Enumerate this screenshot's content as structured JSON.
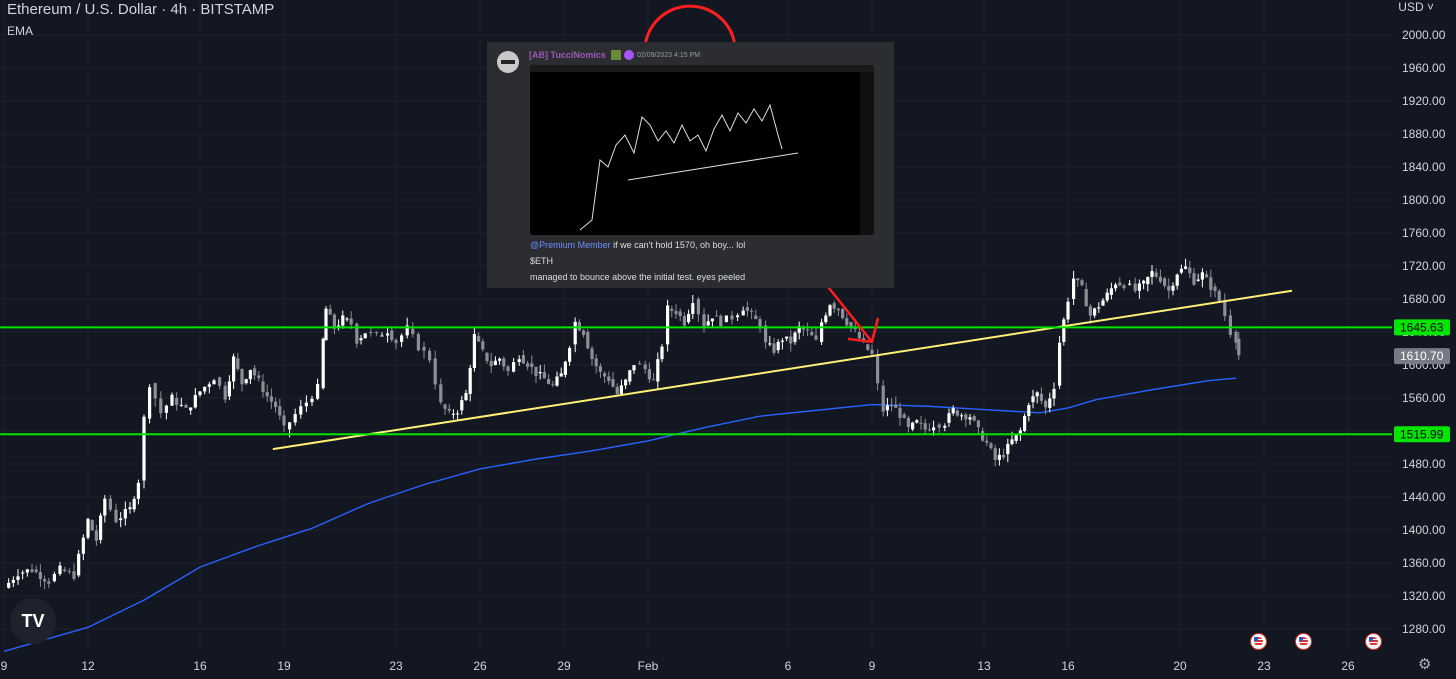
{
  "header": {
    "title": "Ethereum / U.S. Dollar · 4h · BITSTAMP",
    "indicator": "EMA",
    "currency": "USD"
  },
  "colors": {
    "background": "#131722",
    "candle_up": "#ffffff",
    "candle_down": "#8a8f98",
    "ema": "#2962ff",
    "trendline": "#fff176",
    "level": "#00e600",
    "annotation": "#ff1e1e"
  },
  "chart_data": {
    "type": "candlestick",
    "y_axis": {
      "min": 1260,
      "max": 2020,
      "ticks": [
        1280,
        1320,
        1360,
        1400,
        1440,
        1480,
        1520,
        1560,
        1600,
        1640,
        1680,
        1720,
        1760,
        1800,
        1840,
        1880,
        1920,
        1960,
        2000
      ],
      "tick_labels": [
        "1280.00",
        "1320.00",
        "1360.00",
        "1400.00",
        "1440.00",
        "1480.00",
        "1520.00",
        "1560.00",
        "1600.00",
        "1640.00",
        "1680.00",
        "1720.00",
        "1760.00",
        "1800.00",
        "1840.00",
        "1880.00",
        "1920.00",
        "1960.00",
        "2000.00"
      ]
    },
    "x_axis": {
      "min": 9,
      "max": 36.5,
      "ticks": [
        {
          "x": 9,
          "label": "9"
        },
        {
          "x": 12,
          "label": "12"
        },
        {
          "x": 16,
          "label": "16"
        },
        {
          "x": 19,
          "label": "19"
        },
        {
          "x": 23,
          "label": "23"
        },
        {
          "x": 26,
          "label": "26"
        },
        {
          "x": 29,
          "label": "29"
        },
        {
          "x": 32,
          "label": "Feb"
        },
        {
          "x": 37,
          "label": "6"
        },
        {
          "x": 40,
          "label": "9"
        },
        {
          "x": 44,
          "label": "13"
        },
        {
          "x": 47,
          "label": "16"
        },
        {
          "x": 51,
          "label": "20"
        },
        {
          "x": 54,
          "label": "23"
        },
        {
          "x": 57,
          "label": "26"
        }
      ]
    },
    "horizontal_levels": [
      {
        "price": 1645.63,
        "label": "1645.63"
      },
      {
        "price": 1515.99,
        "label": "1515.99"
      }
    ],
    "last_price": {
      "price": 1610.7,
      "label": "1610.70"
    },
    "price_path": [
      [
        9.0,
        1330
      ],
      [
        9.5,
        1348
      ],
      [
        10.0,
        1352
      ],
      [
        10.6,
        1338
      ],
      [
        11.0,
        1352
      ],
      [
        11.5,
        1345
      ],
      [
        12.0,
        1412
      ],
      [
        12.3,
        1388
      ],
      [
        12.6,
        1438
      ],
      [
        13.0,
        1412
      ],
      [
        13.5,
        1425
      ],
      [
        13.8,
        1460
      ],
      [
        14.0,
        1535
      ],
      [
        14.2,
        1578
      ],
      [
        14.6,
        1542
      ],
      [
        15.0,
        1560
      ],
      [
        15.5,
        1545
      ],
      [
        16.0,
        1568
      ],
      [
        16.5,
        1585
      ],
      [
        16.9,
        1562
      ],
      [
        17.2,
        1608
      ],
      [
        17.5,
        1578
      ],
      [
        17.8,
        1596
      ],
      [
        18.1,
        1580
      ],
      [
        18.4,
        1562
      ],
      [
        18.7,
        1550
      ],
      [
        19.0,
        1522
      ],
      [
        19.4,
        1540
      ],
      [
        19.8,
        1555
      ],
      [
        20.2,
        1572
      ],
      [
        20.4,
        1630
      ],
      [
        20.5,
        1668
      ],
      [
        20.8,
        1645
      ],
      [
        21.1,
        1656
      ],
      [
        21.4,
        1650
      ],
      [
        21.6,
        1630
      ],
      [
        21.9,
        1640
      ],
      [
        22.3,
        1635
      ],
      [
        22.7,
        1642
      ],
      [
        23.0,
        1628
      ],
      [
        23.4,
        1644
      ],
      [
        23.8,
        1622
      ],
      [
        24.2,
        1608
      ],
      [
        24.6,
        1552
      ],
      [
        24.9,
        1540
      ],
      [
        25.2,
        1545
      ],
      [
        25.5,
        1565
      ],
      [
        25.8,
        1635
      ],
      [
        26.1,
        1615
      ],
      [
        26.4,
        1600
      ],
      [
        26.7,
        1608
      ],
      [
        27.0,
        1592
      ],
      [
        27.4,
        1612
      ],
      [
        27.7,
        1602
      ],
      [
        28.0,
        1590
      ],
      [
        28.3,
        1583
      ],
      [
        28.6,
        1575
      ],
      [
        28.9,
        1588
      ],
      [
        29.2,
        1625
      ],
      [
        29.4,
        1652
      ],
      [
        29.7,
        1640
      ],
      [
        30.0,
        1608
      ],
      [
        30.3,
        1590
      ],
      [
        30.6,
        1583
      ],
      [
        30.9,
        1565
      ],
      [
        31.2,
        1580
      ],
      [
        31.5,
        1602
      ],
      [
        31.9,
        1595
      ],
      [
        32.2,
        1580
      ],
      [
        32.5,
        1625
      ],
      [
        32.7,
        1668
      ],
      [
        33.0,
        1665
      ],
      [
        33.3,
        1652
      ],
      [
        33.6,
        1680
      ],
      [
        34.0,
        1648
      ],
      [
        34.3,
        1660
      ],
      [
        34.6,
        1652
      ],
      [
        35.0,
        1658
      ],
      [
        35.4,
        1670
      ],
      [
        35.7,
        1660
      ],
      [
        36.0,
        1648
      ],
      [
        36.2,
        1625
      ],
      [
        36.5,
        1618
      ],
      [
        36.8,
        1632
      ],
      [
        37.1,
        1628
      ],
      [
        37.4,
        1645
      ],
      [
        37.7,
        1640
      ],
      [
        38.0,
        1628
      ],
      [
        38.2,
        1652
      ],
      [
        38.5,
        1675
      ],
      [
        38.8,
        1668
      ],
      [
        39.1,
        1652
      ],
      [
        39.4,
        1640
      ],
      [
        39.7,
        1625
      ],
      [
        40.0,
        1612
      ],
      [
        40.2,
        1575
      ],
      [
        40.4,
        1545
      ],
      [
        40.7,
        1552
      ],
      [
        41.0,
        1540
      ],
      [
        41.3,
        1522
      ],
      [
        41.6,
        1530
      ],
      [
        41.9,
        1522
      ],
      [
        42.2,
        1528
      ],
      [
        42.6,
        1530
      ],
      [
        42.9,
        1545
      ],
      [
        43.2,
        1540
      ],
      [
        43.5,
        1538
      ],
      [
        43.8,
        1520
      ],
      [
        44.1,
        1505
      ],
      [
        44.4,
        1485
      ],
      [
        44.7,
        1492
      ],
      [
        45.0,
        1508
      ],
      [
        45.3,
        1520
      ],
      [
        45.6,
        1555
      ],
      [
        45.9,
        1565
      ],
      [
        46.2,
        1548
      ],
      [
        46.5,
        1575
      ],
      [
        46.7,
        1628
      ],
      [
        47.0,
        1680
      ],
      [
        47.2,
        1705
      ],
      [
        47.5,
        1692
      ],
      [
        47.8,
        1660
      ],
      [
        48.1,
        1672
      ],
      [
        48.4,
        1685
      ],
      [
        48.7,
        1700
      ],
      [
        49.0,
        1698
      ],
      [
        49.4,
        1690
      ],
      [
        49.7,
        1698
      ],
      [
        50.0,
        1712
      ],
      [
        50.3,
        1705
      ],
      [
        50.6,
        1690
      ],
      [
        50.9,
        1712
      ],
      [
        51.2,
        1718
      ],
      [
        51.5,
        1702
      ],
      [
        51.8,
        1710
      ],
      [
        52.1,
        1695
      ],
      [
        52.4,
        1678
      ],
      [
        52.6,
        1660
      ],
      [
        52.8,
        1640
      ],
      [
        53.0,
        1632
      ],
      [
        53.1,
        1612
      ]
    ],
    "ema_series": [
      [
        9,
        1253
      ],
      [
        12,
        1282
      ],
      [
        14,
        1315
      ],
      [
        16,
        1355
      ],
      [
        18,
        1380
      ],
      [
        20,
        1402
      ],
      [
        22,
        1432
      ],
      [
        24,
        1455
      ],
      [
        26,
        1474
      ],
      [
        28,
        1486
      ],
      [
        30,
        1496
      ],
      [
        32,
        1508
      ],
      [
        34,
        1524
      ],
      [
        36,
        1538
      ],
      [
        38,
        1545
      ],
      [
        40,
        1552
      ],
      [
        42,
        1550
      ],
      [
        44,
        1546
      ],
      [
        46,
        1542
      ],
      [
        47,
        1548
      ],
      [
        48,
        1558
      ],
      [
        50,
        1570
      ],
      [
        52,
        1581
      ],
      [
        53,
        1584
      ]
    ],
    "trend_line": [
      [
        18.6,
        1498
      ],
      [
        55.0,
        1690
      ]
    ],
    "annotation_circle": {
      "center": [
        33.5,
        1980
      ],
      "radius_price": 55
    },
    "annotation_arrow": [
      [
        33.6,
        1900
      ],
      [
        40.0,
        1628
      ]
    ],
    "event_markers_x": [
      53.8,
      55.4,
      57.9
    ]
  },
  "popup": {
    "username": "[AB] TucciNomics",
    "timestamp": "02/09/2023 4:15 PM",
    "mention": "@Premium Member",
    "line1": "if we can't hold 1570, oh boy... lol",
    "line2": "$ETH",
    "line3": "managed to bounce above the initial test. eyes peeled"
  }
}
